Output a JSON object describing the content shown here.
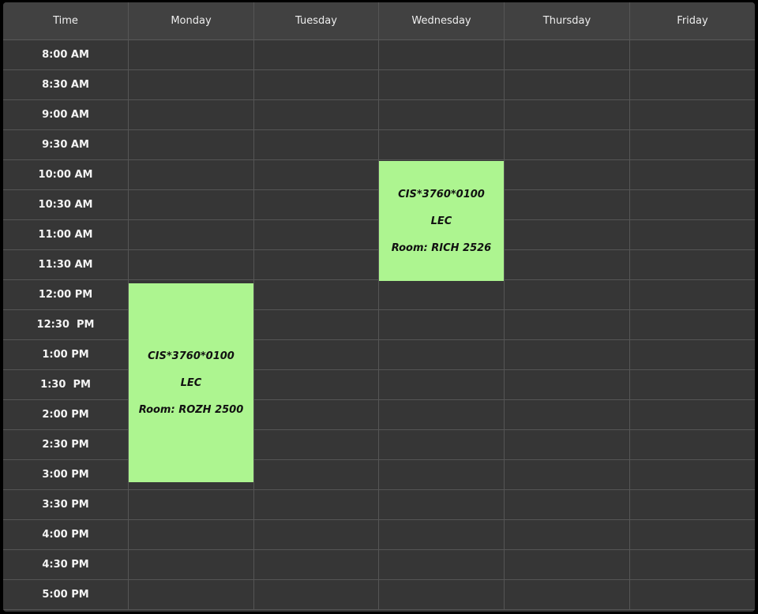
{
  "headers": [
    "Time",
    "Monday",
    "Tuesday",
    "Wednesday",
    "Thursday",
    "Friday"
  ],
  "times": [
    "8:00 AM",
    "8:30 AM",
    "9:00 AM",
    "9:30 AM",
    "10:00 AM",
    "10:30 AM",
    "11:00 AM",
    "11:30 AM",
    "12:00 PM",
    "12:30  PM",
    "1:00 PM",
    "1:30  PM",
    "2:00 PM",
    "2:30 PM",
    "3:00 PM",
    "3:30 PM",
    "4:00 PM",
    "4:30 PM",
    "5:00 PM"
  ],
  "events": [
    {
      "day": "Wednesday",
      "start": "10:00 AM",
      "end": "12:00 PM",
      "course": "CIS*3760*0100",
      "type": "LEC",
      "room": "Room: RICH 2526",
      "color": "#adf590"
    },
    {
      "day": "Monday",
      "start": "12:00 PM",
      "end": "3:30 PM",
      "course": "CIS*3760*0100",
      "type": "LEC",
      "room": "Room: ROZH 2500",
      "color": "#adf590"
    }
  ],
  "colors": {
    "header_bg": "#414141",
    "cell_bg": "#363636",
    "grid_line": "#555555",
    "event_bg": "#adf590"
  }
}
